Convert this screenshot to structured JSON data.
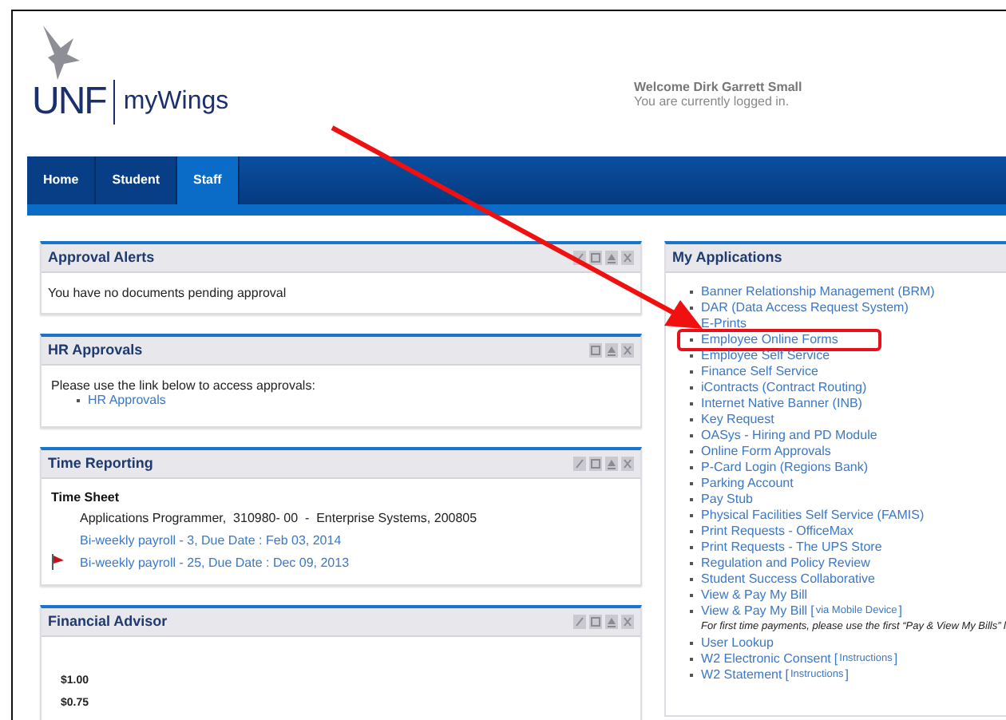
{
  "header": {
    "logo": {
      "abbr": "UNF",
      "product": "myWings"
    },
    "welcome": "Welcome Dirk Garrett Small",
    "status": "You are currently logged in."
  },
  "nav": {
    "tabs": [
      {
        "label": "Home",
        "selected": false
      },
      {
        "label": "Student",
        "selected": false
      },
      {
        "label": "Staff",
        "selected": true
      }
    ]
  },
  "left_panels": [
    {
      "title": "Approval Alerts",
      "edit_tool": true,
      "body": {
        "kind": "message",
        "text": "You have no documents pending approval"
      }
    },
    {
      "title": "HR Approvals",
      "edit_tool": false,
      "body": {
        "kind": "links",
        "intro": "Please use the link below to access approvals:",
        "links": [
          "HR Approvals"
        ]
      }
    },
    {
      "title": "Time Reporting",
      "edit_tool": true,
      "body": {
        "kind": "timesheet",
        "heading": "Time Sheet",
        "position": "Applications Programmer,  310980- 00  -  Enterprise Systems, 200805",
        "entries": [
          {
            "text": "Bi-weekly payroll - 3, Due Date : Feb 03, 2014",
            "flagged": false
          },
          {
            "text": "Bi-weekly payroll - 25, Due Date : Dec 09, 2013",
            "flagged": true
          }
        ]
      }
    },
    {
      "title": "Financial Advisor",
      "edit_tool": true,
      "body": {
        "kind": "chart",
        "labels": [
          "$1.00",
          "$0.75"
        ]
      }
    }
  ],
  "applications": {
    "title": "My Applications",
    "items": [
      {
        "kind": "link",
        "text": "Banner Relationship Management (BRM)",
        "highlighted": false
      },
      {
        "kind": "link",
        "text": "DAR (Data Access Request System)",
        "highlighted": false
      },
      {
        "kind": "link",
        "text": "E-Prints",
        "highlighted": false
      },
      {
        "kind": "link",
        "text": "Employee Online Forms",
        "highlighted": true
      },
      {
        "kind": "link",
        "text": "Employee Self Service",
        "highlighted": false
      },
      {
        "kind": "link",
        "text": "Finance Self Service",
        "highlighted": false
      },
      {
        "kind": "link",
        "text": "iContracts (Contract Routing)",
        "highlighted": false
      },
      {
        "kind": "link",
        "text": "Internet Native Banner (INB)",
        "highlighted": false
      },
      {
        "kind": "link",
        "text": "Key Request",
        "highlighted": false
      },
      {
        "kind": "link",
        "text": "OASys - Hiring and PD Module",
        "highlighted": false
      },
      {
        "kind": "link",
        "text": "Online Form Approvals",
        "highlighted": false
      },
      {
        "kind": "link",
        "text": "P-Card Login (Regions Bank)",
        "highlighted": false
      },
      {
        "kind": "link",
        "text": "Parking Account",
        "highlighted": false
      },
      {
        "kind": "link",
        "text": "Pay Stub",
        "highlighted": false
      },
      {
        "kind": "link",
        "text": "Physical Facilities Self Service (FAMIS)",
        "highlighted": false
      },
      {
        "kind": "link",
        "text": "Print Requests - OfficeMax",
        "highlighted": false
      },
      {
        "kind": "link",
        "text": "Print Requests - The UPS Store",
        "highlighted": false
      },
      {
        "kind": "link",
        "text": "Regulation and Policy Review",
        "highlighted": false
      },
      {
        "kind": "link",
        "text": "Student Success Collaborative",
        "highlighted": false
      },
      {
        "kind": "link",
        "text": "View & Pay My Bill",
        "highlighted": false
      },
      {
        "kind": "link",
        "text": "View & Pay My Bill",
        "extra": "via Mobile Device",
        "brackets": [
          "[",
          "]"
        ],
        "highlighted": false
      },
      {
        "kind": "note",
        "text": "For first time payments, please use the first “Pay & View My Bills” l"
      },
      {
        "kind": "link",
        "text": "User Lookup",
        "highlighted": false
      },
      {
        "kind": "link",
        "text": "W2 Electronic Consent",
        "extra": "Instructions",
        "brackets": [
          "[",
          "]"
        ],
        "highlighted": false
      },
      {
        "kind": "link",
        "text": "W2 Statement",
        "extra": "Instructions",
        "brackets": [
          "[",
          "]"
        ],
        "highlighted": false
      }
    ]
  }
}
